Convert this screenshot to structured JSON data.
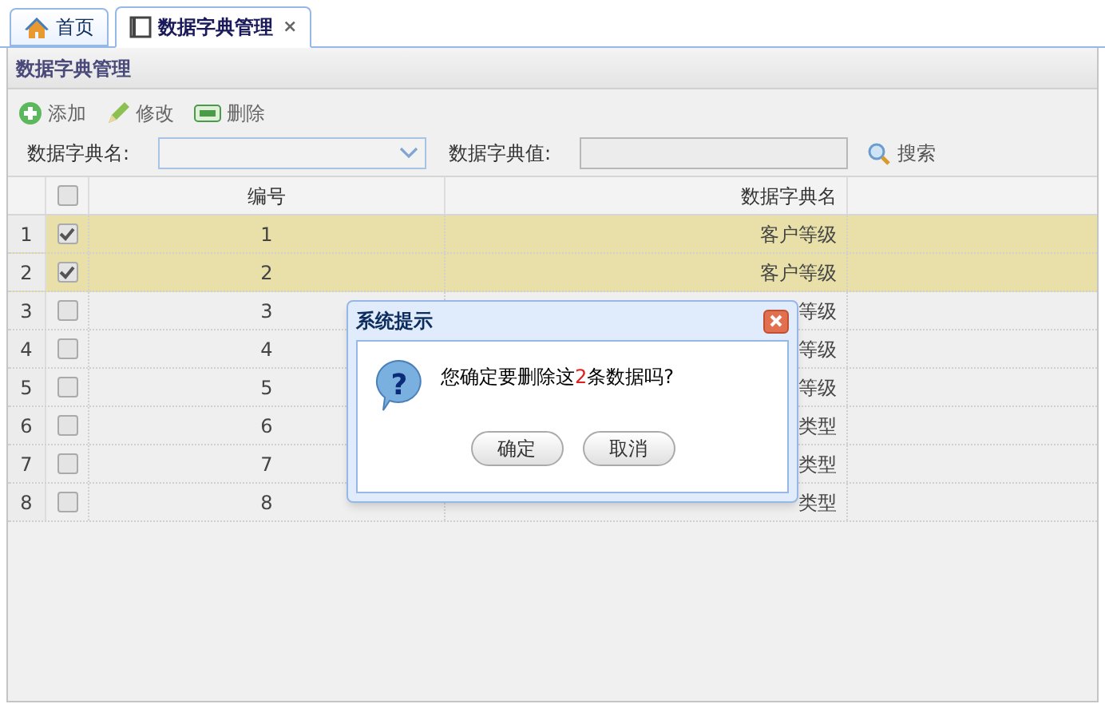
{
  "tabs": [
    {
      "label": "首页",
      "selected": false
    },
    {
      "label": "数据字典管理",
      "selected": true,
      "close": "×"
    }
  ],
  "panel": {
    "title": "数据字典管理"
  },
  "toolbar": [
    {
      "label": "添加"
    },
    {
      "label": "修改"
    },
    {
      "label": "删除"
    }
  ],
  "search": {
    "name_label": "数据字典名:",
    "value_label": "数据字典值:",
    "button": "搜索"
  },
  "table": {
    "columns": [
      "编号",
      "数据字典名"
    ],
    "all_checked": false,
    "rows": [
      {
        "num": "1",
        "checked": true,
        "selected": true,
        "id": "1",
        "name": "客户等级"
      },
      {
        "num": "2",
        "checked": true,
        "selected": true,
        "id": "2",
        "name": "客户等级"
      },
      {
        "num": "3",
        "checked": false,
        "selected": false,
        "id": "3",
        "name": "等级"
      },
      {
        "num": "4",
        "checked": false,
        "selected": false,
        "id": "4",
        "name": "等级"
      },
      {
        "num": "5",
        "checked": false,
        "selected": false,
        "id": "5",
        "name": "等级"
      },
      {
        "num": "6",
        "checked": false,
        "selected": false,
        "id": "6",
        "name": "类型"
      },
      {
        "num": "7",
        "checked": false,
        "selected": false,
        "id": "7",
        "name": "类型"
      },
      {
        "num": "8",
        "checked": false,
        "selected": false,
        "id": "8",
        "name": "类型"
      }
    ]
  },
  "dialog": {
    "title": "系统提示",
    "icon": "?",
    "message_before": "您确定要删除这",
    "count": "2",
    "message_after": "条数据吗?",
    "buttons": [
      "确定",
      "取消"
    ]
  }
}
